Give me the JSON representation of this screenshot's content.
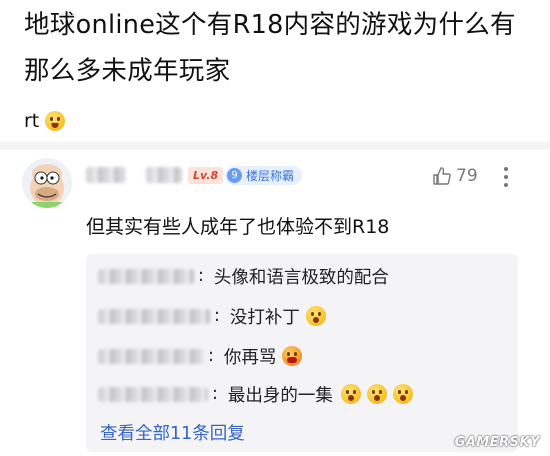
{
  "post": {
    "title": "地球online这个有R18内容的游戏为什么有那么多未成年玩家",
    "body_text": "rt"
  },
  "comment": {
    "level_badge": "Lv.8",
    "floor_badge_num": "9",
    "floor_badge_text": "楼层称霸",
    "like_count": "79",
    "text": "但其实有些人成年了也体验不到R18"
  },
  "replies": [
    {
      "text": "头像和语言极致的配合",
      "emojis": []
    },
    {
      "text": "没打补丁",
      "emojis": [
        "shocked-face"
      ]
    },
    {
      "text": "你再骂",
      "emojis": [
        "angry-face"
      ]
    },
    {
      "text": "最出身的一集",
      "emojis": [
        "shocked-face",
        "shocked-face",
        "shocked-face"
      ]
    }
  ],
  "view_all_replies": "查看全部11条回复",
  "watermark": "GAMERSKY",
  "colors": {
    "link_blue": "#3464c8",
    "level_red": "#d4442a",
    "badge_blue": "#3a72d8",
    "reply_bg": "#f4f4f6"
  }
}
